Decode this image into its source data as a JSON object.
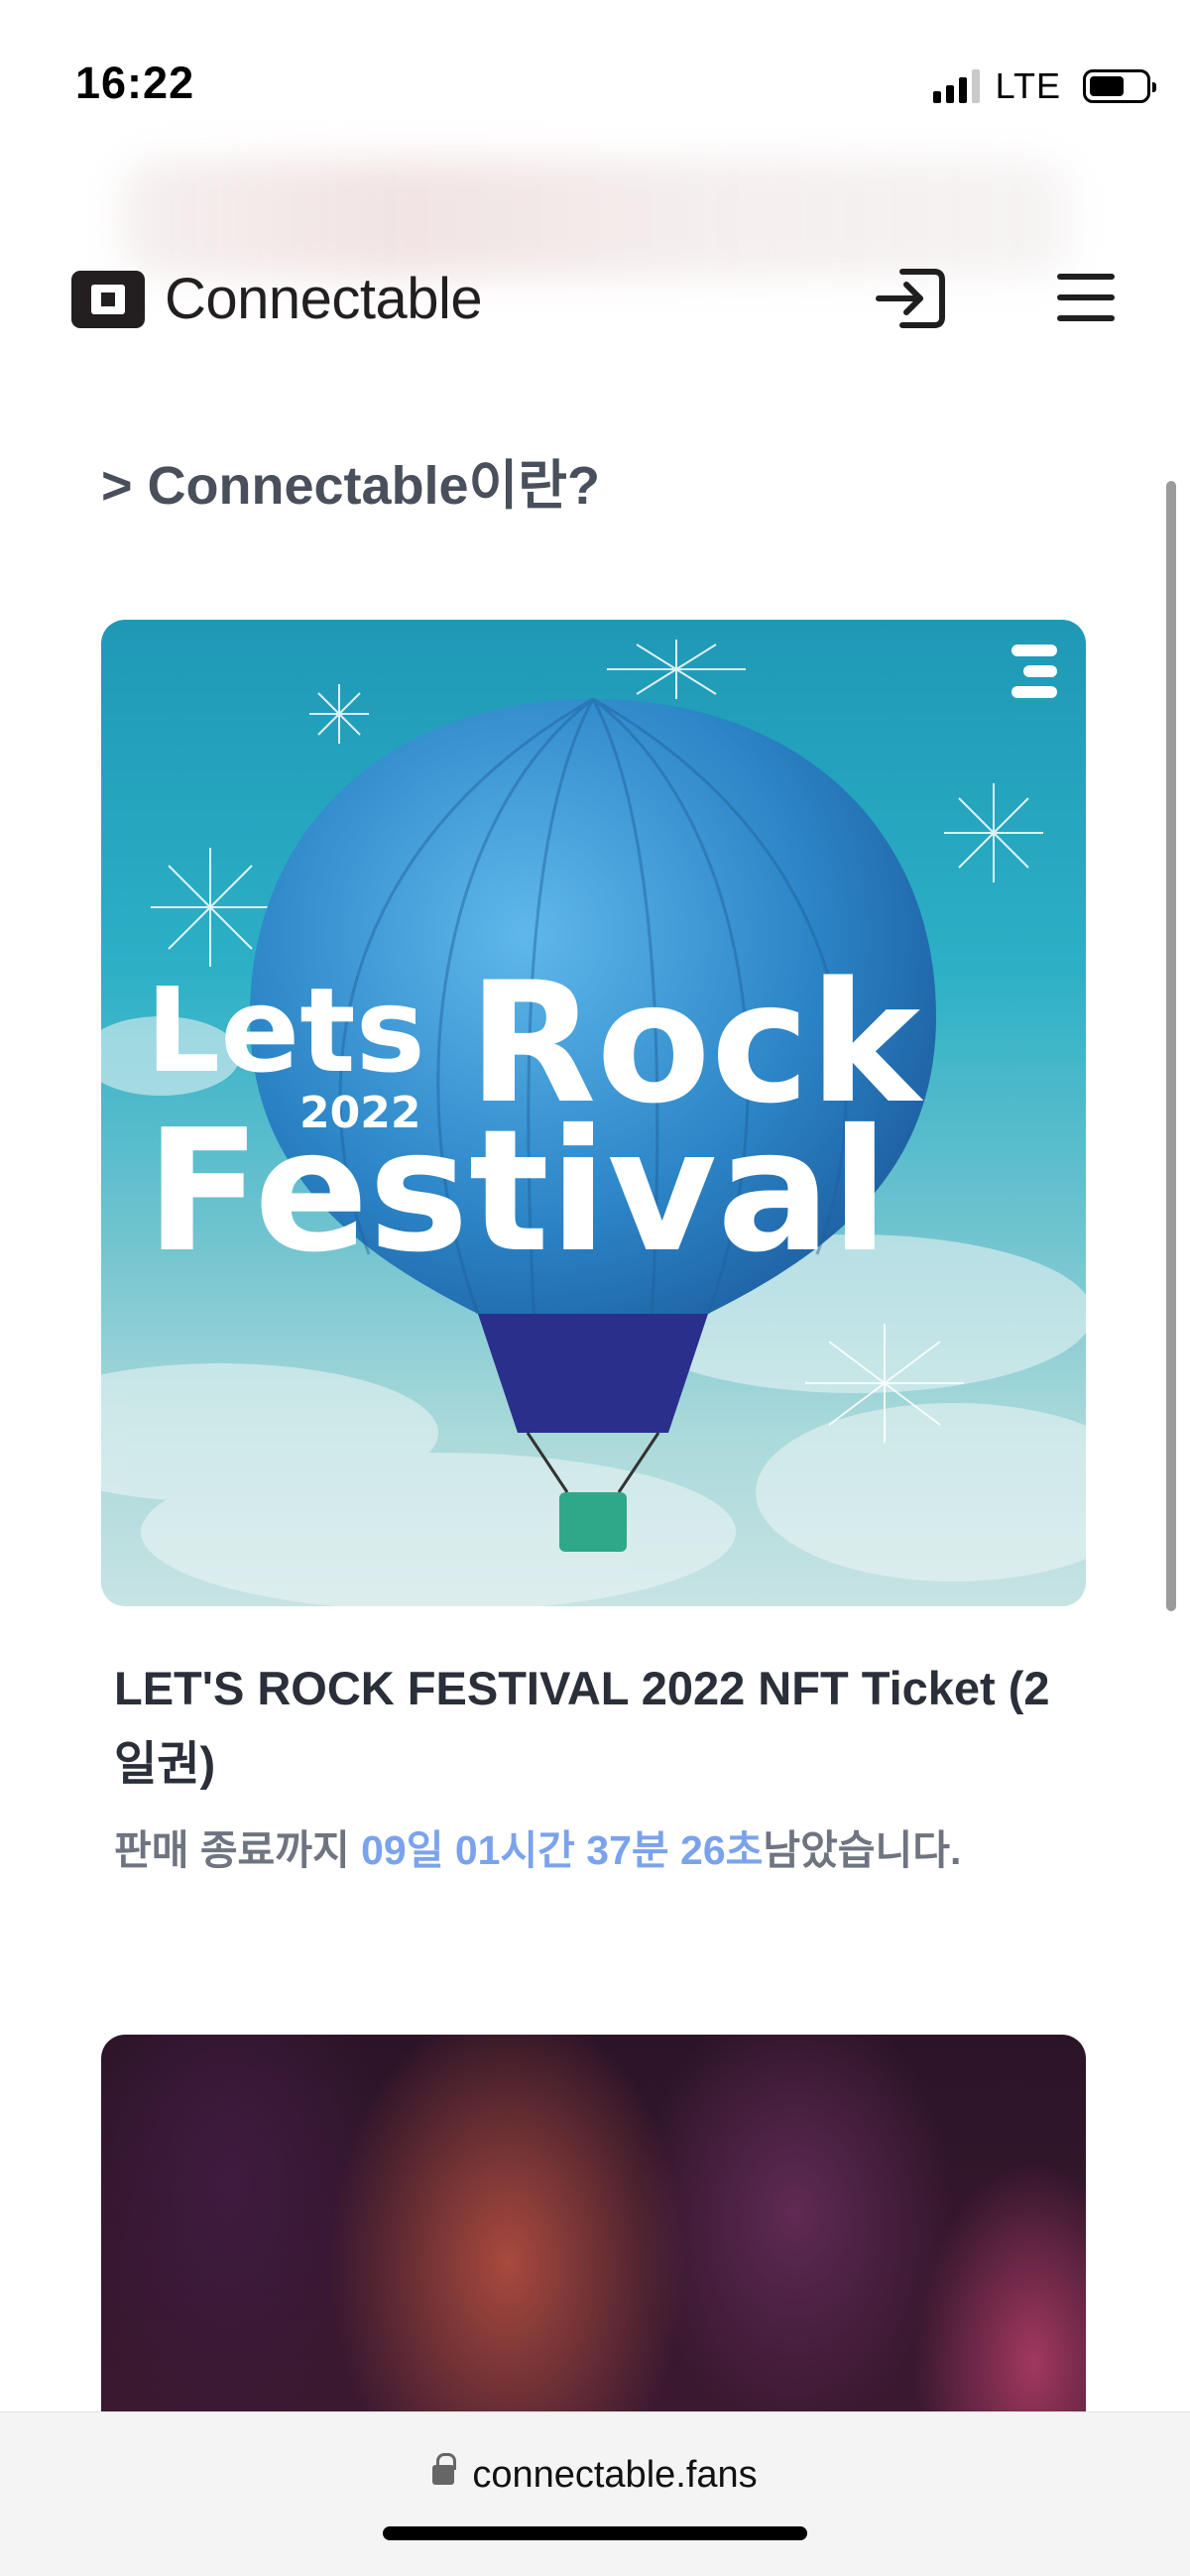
{
  "status_bar": {
    "time": "16:22",
    "network": "LTE",
    "battery_level": 0.6
  },
  "header": {
    "brand": "Connectable",
    "login_icon": "login-icon",
    "menu_icon": "hamburger-menu-icon"
  },
  "section": {
    "title": "> Connectable이란?"
  },
  "card": {
    "image_text": {
      "lets": "Lets",
      "rock": "Rock",
      "year": "2022",
      "festival": "Festival"
    },
    "title": "LET'S ROCK FESTIVAL 2022 NFT Ticket (2일권)",
    "countdown": {
      "prefix": "판매 종료까지 ",
      "days": "09일",
      "hours": "01시간",
      "minutes": "37분",
      "seconds": "26초",
      "suffix": "남았습니다."
    }
  },
  "browser": {
    "url": "connectable.fans"
  },
  "colors": {
    "accent": "#7ba3ec",
    "text_primary": "#2a2f3a",
    "text_secondary": "#6f7481"
  }
}
